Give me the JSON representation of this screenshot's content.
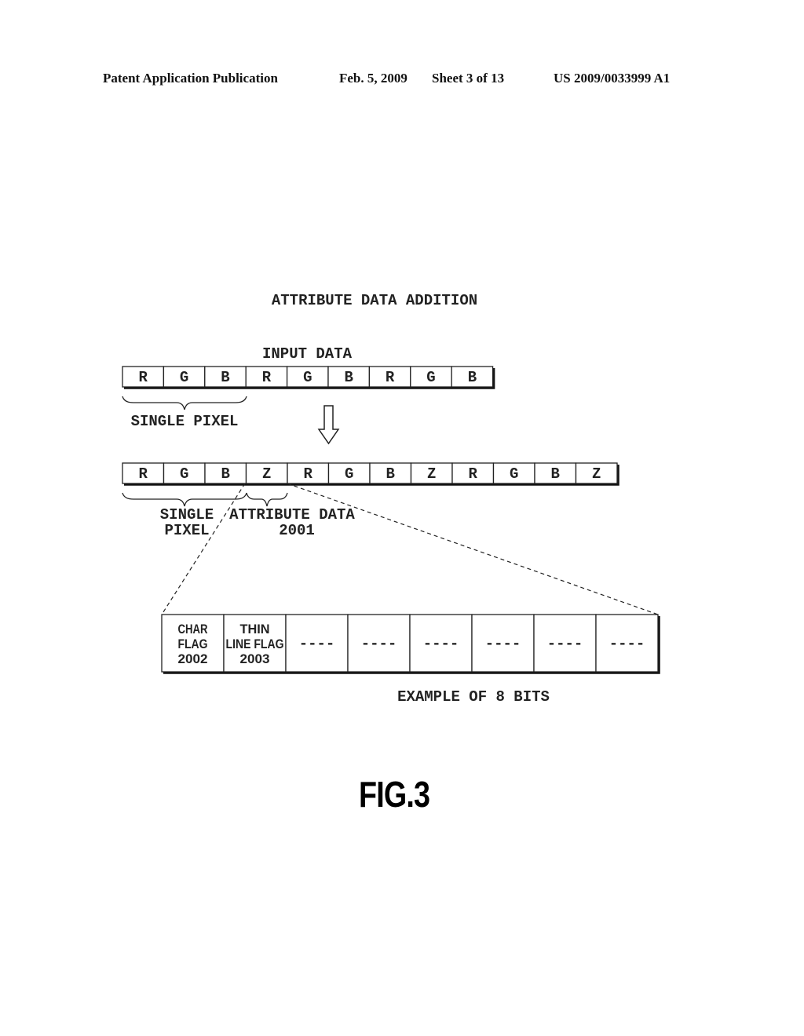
{
  "header": {
    "left": "Patent Application Publication",
    "date": "Feb. 5, 2009",
    "sheet": "Sheet 3 of 13",
    "number": "US 2009/0033999 A1"
  },
  "diagram": {
    "title": "ATTRIBUTE DATA ADDITION",
    "input_label": "INPUT DATA",
    "input_cells": [
      "R",
      "G",
      "B",
      "R",
      "G",
      "B",
      "R",
      "G",
      "B"
    ],
    "single_pixel_label": "SINGLE PIXEL",
    "output_cells": [
      "R",
      "G",
      "B",
      "Z",
      "R",
      "G",
      "B",
      "Z",
      "R",
      "G",
      "B",
      "Z"
    ],
    "single_pixel_label_line1": "SINGLE",
    "single_pixel_label_line2": "PIXEL",
    "attribute_label_line1": "ATTRIBUTE DATA",
    "attribute_label_line2": "2001",
    "bit_cells": [
      [
        "CHAR",
        "FLAG",
        "2002"
      ],
      [
        "THIN",
        "LINE FLAG",
        "2003"
      ],
      [
        "----"
      ],
      [
        "----"
      ],
      [
        "----"
      ],
      [
        "----"
      ],
      [
        "----"
      ],
      [
        "----"
      ]
    ],
    "bits_caption": "EXAMPLE OF 8 BITS"
  },
  "figure_label": "FIG.3"
}
